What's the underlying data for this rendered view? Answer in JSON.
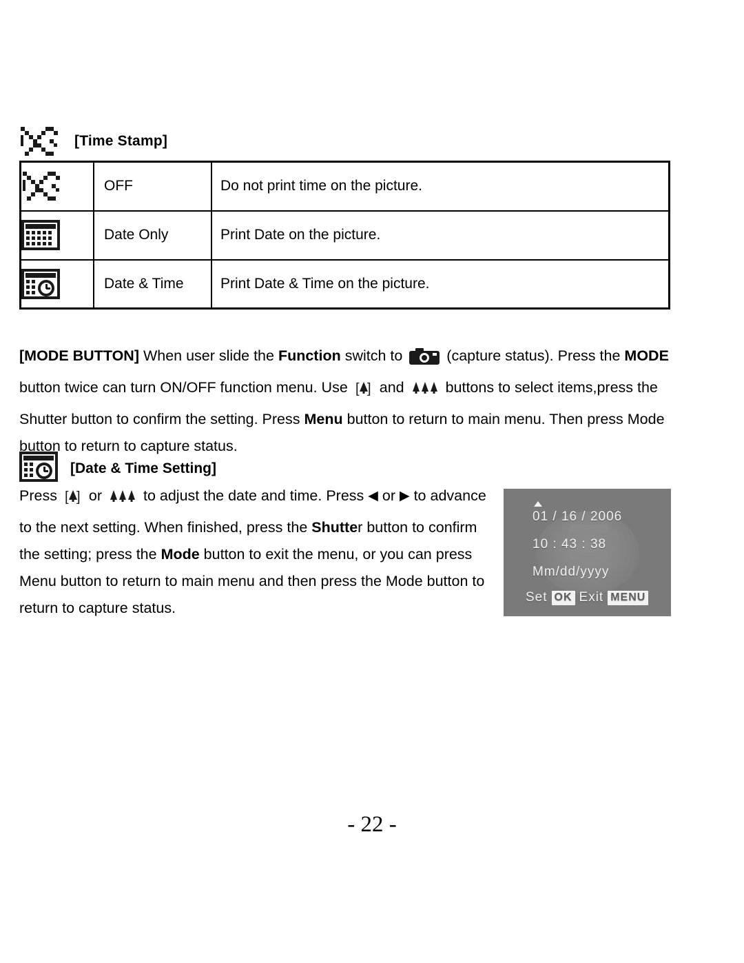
{
  "time_stamp": {
    "heading": "[Time Stamp]",
    "icon": "time-stamp-off-icon",
    "rows": [
      {
        "icon": "stamp-off-icon",
        "name": "OFF",
        "desc": "Do not print time on the picture."
      },
      {
        "icon": "date-only-icon",
        "name": "Date Only",
        "desc": "Print Date on the picture."
      },
      {
        "icon": "date-and-time-icon",
        "name": "Date & Time",
        "desc": "Print Date & Time on the picture."
      }
    ]
  },
  "mode_button": {
    "p1_bold": "[MODE BUTTON]",
    "p1_a": " When user slide the ",
    "p1_bold2": "Function",
    "p1_b": " switch to ",
    "p1_c": " (capture status). Press the ",
    "p2_bold": "MODE",
    "p2_a": " button twice can turn ON/OFF function menu. Use ",
    "p2_b": " and ",
    "p2_c": " buttons to select items,",
    "p3_a": "press the Shutter button to confirm the setting. Press ",
    "p3_bold": "Menu",
    "p3_b": " button to return to main menu.",
    "p4": "Then press Mode button to return to capture status.",
    "camera_icon": "camera-icon",
    "up_icon": "single-tree-button-icon",
    "down_icon": "triple-tree-button-icon"
  },
  "date_time_setting": {
    "heading": "[Date & Time Setting]",
    "icon": "date-and-time-icon",
    "l1_a": "Press ",
    "l1_b": " or ",
    "l1_c": " to adjust the date and time. Press ",
    "l1_left": "◀",
    "l1_d": " or ",
    "l1_right": "▶",
    "l1_e": " to",
    "l2_a": "advance to the next setting. When finished, press the ",
    "l2_bold": "Shutte",
    "l2_b": "r",
    "l3_a": "button to confirm the setting; press the ",
    "l3_bold": "Mode",
    "l3_b": " button to exit",
    "l4": "the menu, or you can press Menu button to return to main",
    "l5": "menu and then press the Mode button to return to capture status."
  },
  "lcd": {
    "date": "01 / 16 / 2006",
    "time": "10 : 43 : 38",
    "format": "Mm/dd/yyyy",
    "set_label": "Set",
    "set_key": "OK",
    "exit_label": "Exit",
    "exit_key": "MENU"
  },
  "page_number": "- 22 -"
}
